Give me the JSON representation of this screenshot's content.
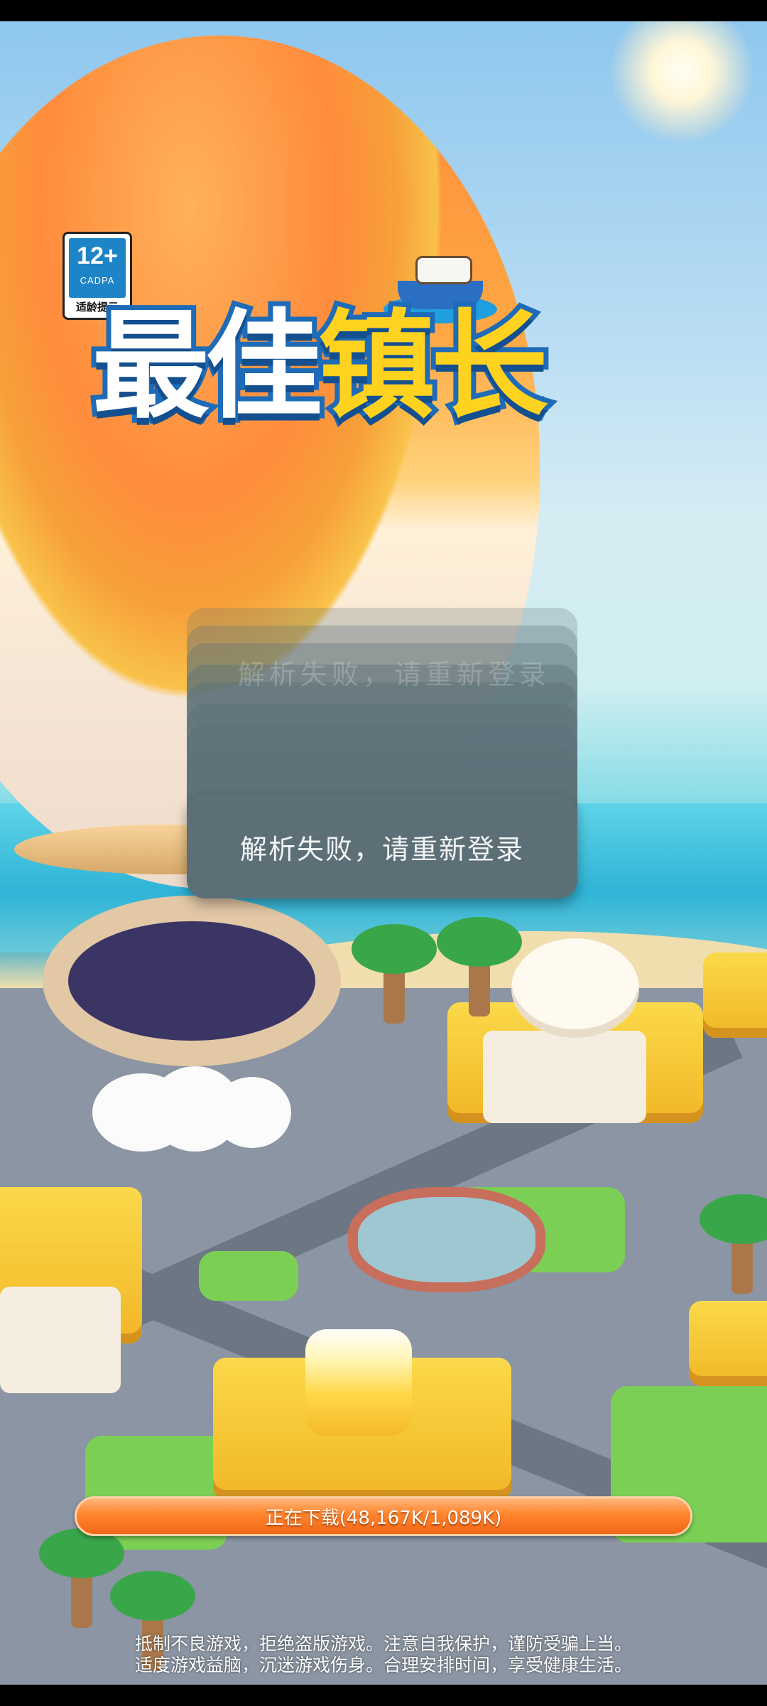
{
  "age_rating": {
    "number": "12+",
    "org": "CADPA",
    "tip": "适龄提示"
  },
  "logo": {
    "part1": "最佳",
    "part2": "镇长"
  },
  "toast": {
    "message": "解析失败，请重新登录",
    "ghost": "解析失败，请重新登录"
  },
  "progress": {
    "label": "正在下载(48,167K/1,089K)",
    "fill_fraction": 1.0
  },
  "health_notice": {
    "line1": "抵制不良游戏，拒绝盗版游戏。注意自我保护，谨防受骗上当。",
    "line2": "适度游戏益脑，沉迷游戏伤身。合理安排时间，享受健康生活。"
  },
  "colors": {
    "progress": "#ff7a1a",
    "toast_bg": "#5c6f77",
    "logo_blue": "#1e6bb8",
    "logo_yellow": "#ffd21f"
  }
}
